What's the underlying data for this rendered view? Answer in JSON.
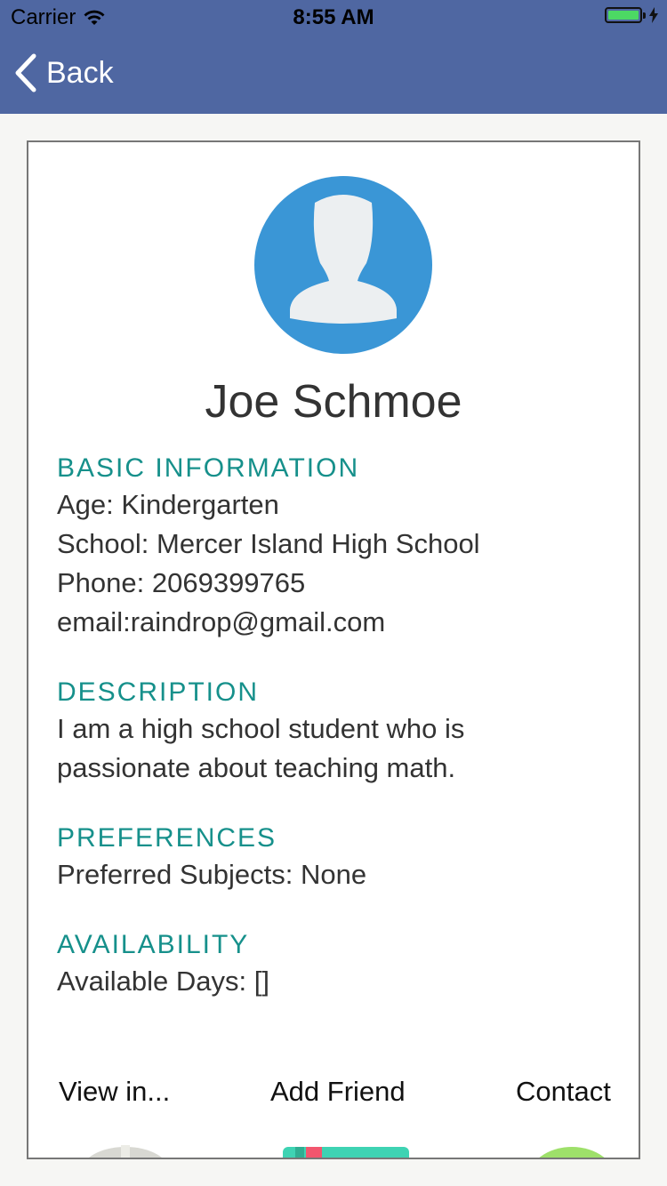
{
  "status_bar": {
    "carrier": "Carrier",
    "time": "8:55 AM"
  },
  "nav": {
    "back_label": "Back"
  },
  "profile": {
    "name": "Joe Schmoe"
  },
  "sections": {
    "basic": {
      "heading": "BASIC INFORMATION",
      "lines": [
        "Age: Kindergarten",
        "School: Mercer Island High School",
        "Phone: 2069399765",
        "email:raindrop@gmail.com"
      ]
    },
    "description": {
      "heading": "DESCRIPTION",
      "lines": [
        "I am a high school student who is",
        "passionate about teaching math."
      ]
    },
    "preferences": {
      "heading": "PREFERENCES",
      "lines": [
        "Preferred Subjects: None"
      ]
    },
    "availability": {
      "heading": "AVAILABILITY",
      "lines": [
        "Available Days: []"
      ]
    }
  },
  "actions": {
    "view_label": "View in...",
    "add_friend_label": "Add Friend",
    "contact_label": "Contact"
  },
  "colors": {
    "nav_bg": "#4f67a2",
    "accent": "#16908b",
    "avatar_bg": "#3a96d6",
    "battery": "#4cd964"
  }
}
